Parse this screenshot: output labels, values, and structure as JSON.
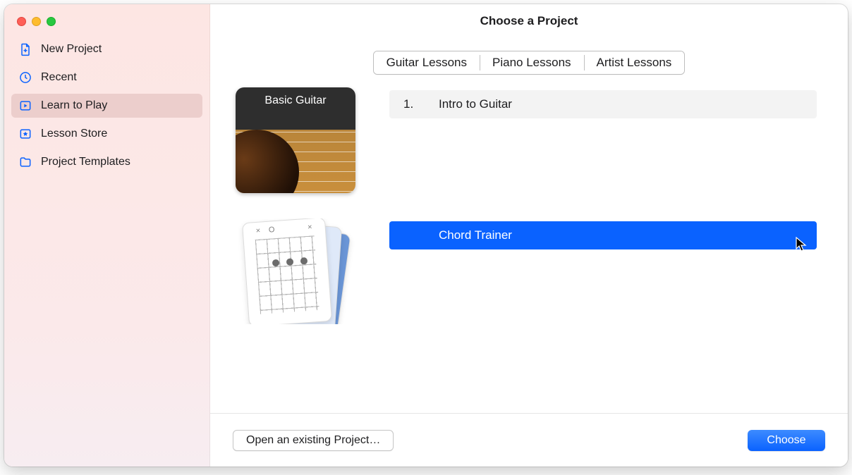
{
  "window": {
    "title": "Choose a Project"
  },
  "sidebar": {
    "items": [
      {
        "label": "New Project",
        "icon": "document-plus-icon",
        "selected": false
      },
      {
        "label": "Recent",
        "icon": "clock-icon",
        "selected": false
      },
      {
        "label": "Learn to Play",
        "icon": "play-lesson-icon",
        "selected": true
      },
      {
        "label": "Lesson Store",
        "icon": "star-box-icon",
        "selected": false
      },
      {
        "label": "Project Templates",
        "icon": "folder-icon",
        "selected": false
      }
    ]
  },
  "tabs": {
    "items": [
      {
        "label": "Guitar Lessons",
        "selected": true
      },
      {
        "label": "Piano Lessons",
        "selected": false
      },
      {
        "label": "Artist Lessons",
        "selected": false
      }
    ]
  },
  "groups": [
    {
      "thumb_label": "Basic Guitar",
      "thumb_kind": "guitar",
      "lessons": [
        {
          "num": "1.",
          "title": "Intro to Guitar",
          "selected": false
        }
      ]
    },
    {
      "thumb_label": "",
      "thumb_kind": "cards",
      "lessons": [
        {
          "num": "",
          "title": "Chord Trainer",
          "selected": true
        }
      ]
    }
  ],
  "footer": {
    "open_label": "Open an existing Project…",
    "choose_label": "Choose"
  }
}
